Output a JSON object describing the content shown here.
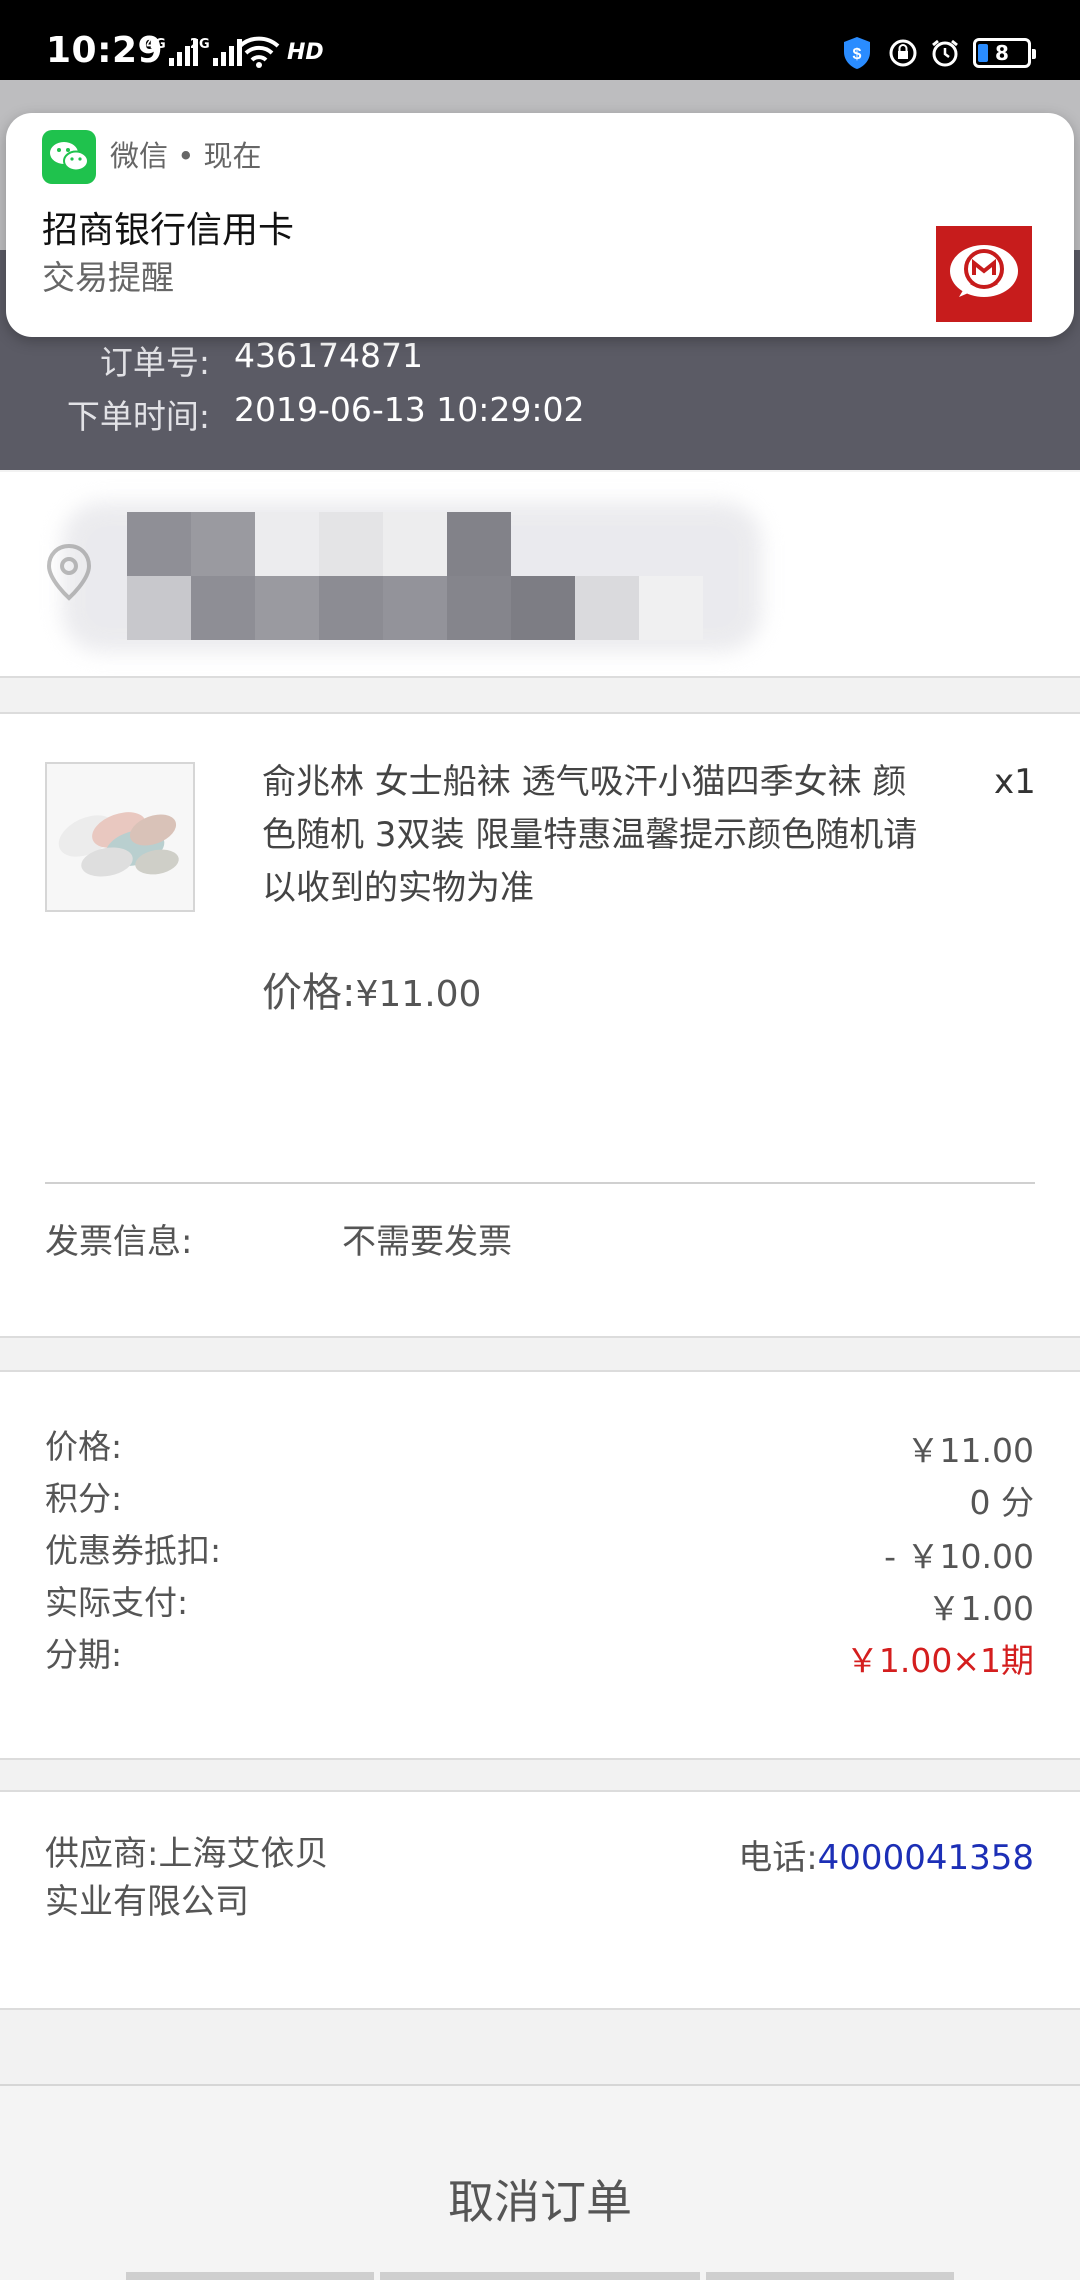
{
  "status_bar": {
    "time": "10:29",
    "signal_1_label": "4G",
    "signal_2_label": "2G",
    "hd_label": "HD",
    "battery_level": "8"
  },
  "notification": {
    "app_line": "微信 • 现在",
    "title": "招商银行信用卡",
    "subtitle": "交易提醒",
    "brand_color": "#c71c1c",
    "app_icon_color": "#1fc24d"
  },
  "order": {
    "number_label": "订单号:",
    "number": "436174871",
    "time_label": "下单时间:",
    "time": "2019-06-13 10:29:02"
  },
  "product": {
    "title": "俞兆林 女士船袜 透气吸汗小猫四季女袜 颜色随机 3双装 限量特惠温馨提示颜色随机请以收到的实物为准",
    "quantity": "x1",
    "price_label": "价格:",
    "price": "¥11.00",
    "invoice_label": "发票信息:",
    "invoice_value": "不需要发票"
  },
  "summary": {
    "rows": [
      {
        "label": "价格:",
        "value": "￥11.00"
      },
      {
        "label": "积分:",
        "value": "0 分"
      },
      {
        "label": "优惠券抵扣:",
        "value": "- ￥10.00"
      },
      {
        "label": "实际支付:",
        "value": "￥1.00"
      },
      {
        "label": "分期:",
        "value": "￥1.00×1期"
      }
    ],
    "installment_color": "#d41e1e"
  },
  "supplier": {
    "name": "供应商:上海艾依贝实业有限公司",
    "phone_label": "电话:",
    "phone": "4000041358"
  },
  "actions": {
    "cancel_label": "取消订单"
  }
}
